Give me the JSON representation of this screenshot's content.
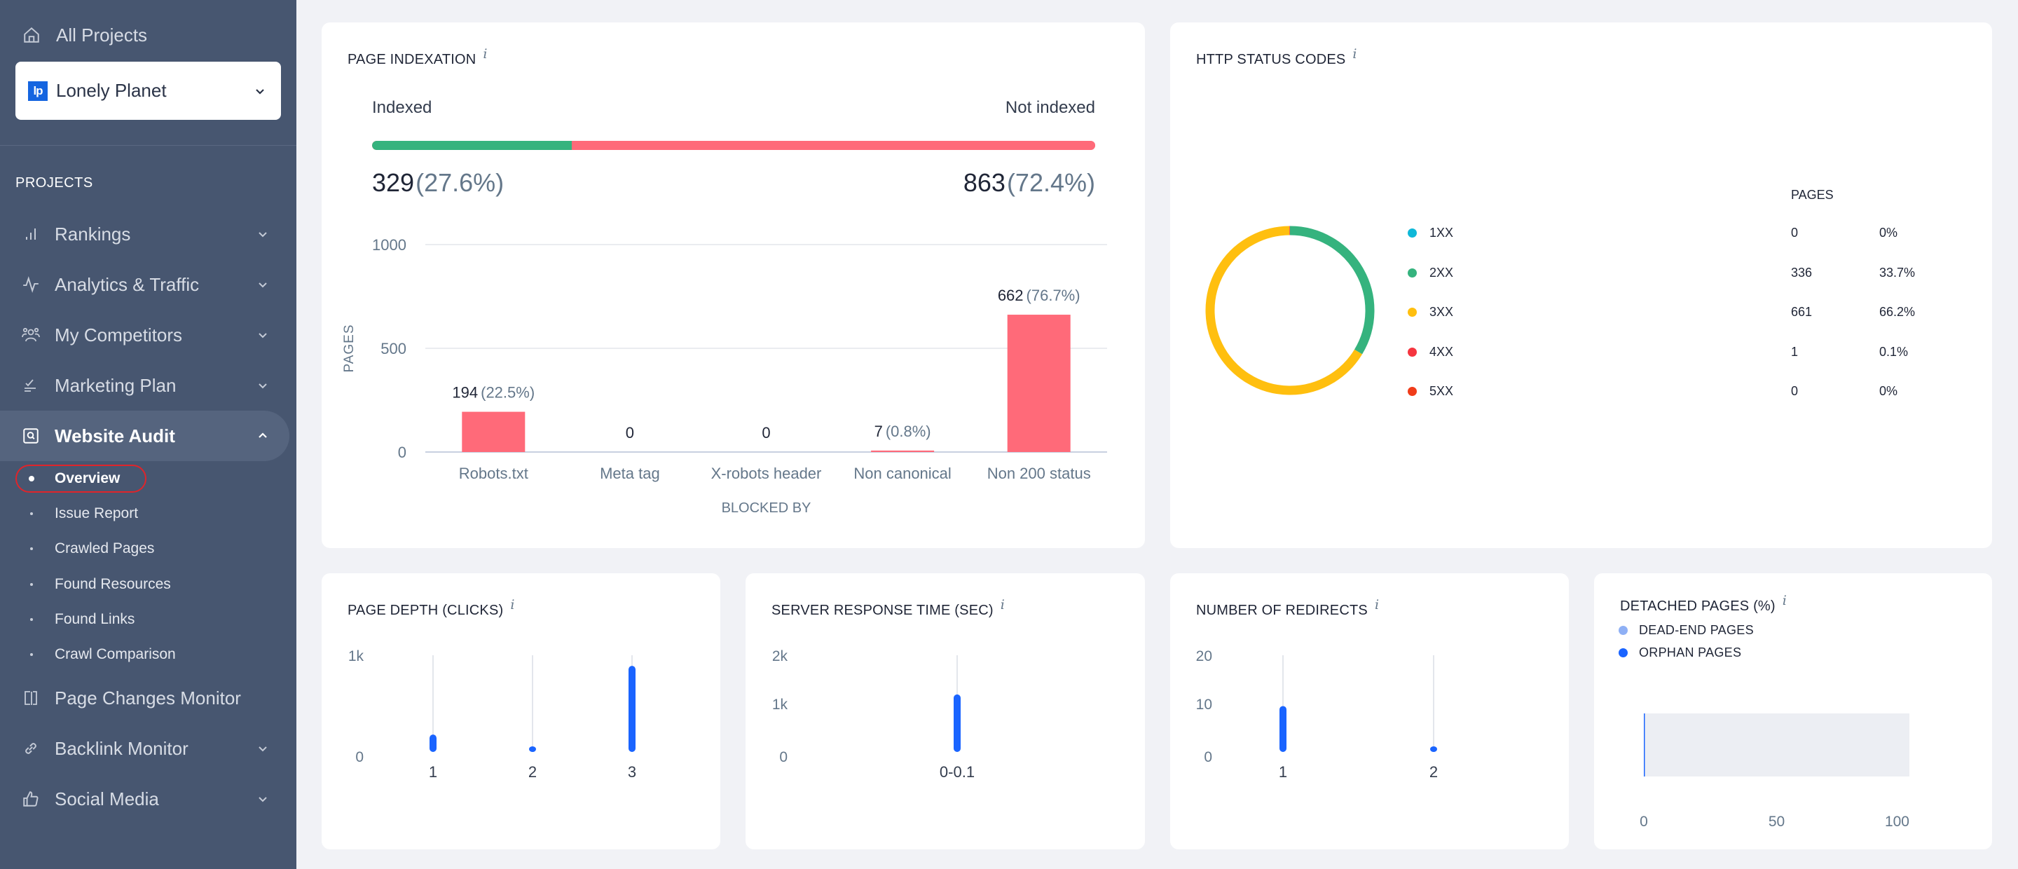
{
  "sidebar": {
    "all_projects": "All Projects",
    "project": {
      "name": "Lonely Planet",
      "logo_text": "lp"
    },
    "section_label": "PROJECTS",
    "items": [
      {
        "label": "Rankings",
        "icon": "bar-chart-icon",
        "expandable": true
      },
      {
        "label": "Analytics & Traffic",
        "icon": "pulse-icon",
        "expandable": true
      },
      {
        "label": "My Competitors",
        "icon": "users-icon",
        "expandable": true
      },
      {
        "label": "Marketing Plan",
        "icon": "checklist-icon",
        "expandable": true
      },
      {
        "label": "Website Audit",
        "icon": "audit-search-icon",
        "expandable": true,
        "expanded": true,
        "active": true
      },
      {
        "label": "Page Changes Monitor",
        "icon": "page-compare-icon",
        "expandable": false
      },
      {
        "label": "Backlink Monitor",
        "icon": "link-icon",
        "expandable": true
      },
      {
        "label": "Social Media",
        "icon": "thumbs-up-icon",
        "expandable": true
      }
    ],
    "website_audit_subitems": [
      {
        "label": "Overview",
        "active": true
      },
      {
        "label": "Issue Report"
      },
      {
        "label": "Crawled Pages"
      },
      {
        "label": "Found Resources"
      },
      {
        "label": "Found Links"
      },
      {
        "label": "Crawl Comparison"
      }
    ]
  },
  "colors": {
    "sidebar_bg": "#475670",
    "indexed": "#35b37e",
    "not_indexed": "#ff6a79",
    "bar_blue": "#1a64ff",
    "status_1xx": "#0fb8d8",
    "status_2xx": "#35b37e",
    "status_3xx": "#ffbf0f",
    "status_4xx": "#f5353f",
    "status_5xx": "#f03c1a",
    "dead_end": "#8fb0f5",
    "orphan": "#1a64ff",
    "highlight_ring": "#e0242a"
  },
  "indexation": {
    "title": "PAGE INDEXATION",
    "indexed_label": "Indexed",
    "not_indexed_label": "Not indexed",
    "indexed_count": "329",
    "indexed_pct": "(27.6%)",
    "not_indexed_count": "863",
    "not_indexed_pct": "(72.4%)",
    "indexed_fraction": 0.276
  },
  "http_status": {
    "title": "HTTP STATUS CODES",
    "pages_header": "PAGES",
    "rows": [
      {
        "code": "1XX",
        "pages": "0",
        "pct": "0%",
        "color": "#0fb8d8"
      },
      {
        "code": "2XX",
        "pages": "336",
        "pct": "33.7%",
        "color": "#35b37e"
      },
      {
        "code": "3XX",
        "pages": "661",
        "pct": "66.2%",
        "color": "#ffbf0f"
      },
      {
        "code": "4XX",
        "pages": "1",
        "pct": "0.1%",
        "color": "#f5353f"
      },
      {
        "code": "5XX",
        "pages": "0",
        "pct": "0%",
        "color": "#f03c1a"
      }
    ]
  },
  "chart_data": [
    {
      "id": "blocked-by",
      "type": "bar",
      "title": "PAGE INDEXATION",
      "xlabel": "BLOCKED BY",
      "ylabel": "PAGES",
      "ylim": [
        0,
        1000
      ],
      "yticks": [
        "0",
        "500",
        "1000"
      ],
      "ytick_values": [
        0,
        500,
        1000
      ],
      "grid": true,
      "categories": [
        "Robots.txt",
        "Meta tag",
        "X-robots header",
        "Non canonical",
        "Non 200 status"
      ],
      "values": [
        194,
        0,
        0,
        7,
        662
      ],
      "value_labels": [
        "194",
        "0",
        "0",
        "7",
        "662"
      ],
      "pct_labels": [
        "(22.5%)",
        "",
        "",
        "(0.8%)",
        "(76.7%)"
      ]
    },
    {
      "id": "http-status",
      "type": "pie",
      "title": "HTTP STATUS CODES",
      "categories": [
        "1XX",
        "2XX",
        "3XX",
        "4XX",
        "5XX"
      ],
      "values": [
        0,
        336,
        661,
        1,
        0
      ],
      "legend": "right"
    },
    {
      "id": "page-depth",
      "type": "bar",
      "title": "PAGE DEPTH (CLICKS)",
      "ylim": [
        0,
        1000
      ],
      "yticks": [
        "0",
        "1k"
      ],
      "ytick_values": [
        0,
        1000
      ],
      "categories": [
        "1",
        "2",
        "3"
      ],
      "values": [
        180,
        10,
        890
      ]
    },
    {
      "id": "server-response",
      "type": "bar",
      "title": "SERVER RESPONSE TIME (SEC)",
      "ylim": [
        0,
        2000
      ],
      "yticks": [
        "0",
        "1k",
        "2k"
      ],
      "ytick_values": [
        0,
        1000,
        2000
      ],
      "categories": [
        "0-0.1"
      ],
      "values": [
        1190
      ]
    },
    {
      "id": "redirects",
      "type": "bar",
      "title": "NUMBER OF REDIRECTS",
      "ylim": [
        0,
        20
      ],
      "yticks": [
        "0",
        "10",
        "20"
      ],
      "ytick_values": [
        0,
        10,
        20
      ],
      "categories": [
        "1",
        "2"
      ],
      "values": [
        9.5,
        0.1
      ]
    },
    {
      "id": "detached-pages",
      "type": "bar",
      "title": "DETACHED PAGES (%)",
      "orientation": "horizontal",
      "xlim": [
        0,
        100
      ],
      "xticks": [
        "0",
        "50",
        "100"
      ],
      "xtick_values": [
        0,
        50,
        100
      ],
      "series": [
        {
          "name": "DEAD-END PAGES",
          "values": [
            0
          ]
        },
        {
          "name": "ORPHAN PAGES",
          "values": [
            0.1
          ]
        }
      ],
      "legend": "top-left"
    }
  ]
}
